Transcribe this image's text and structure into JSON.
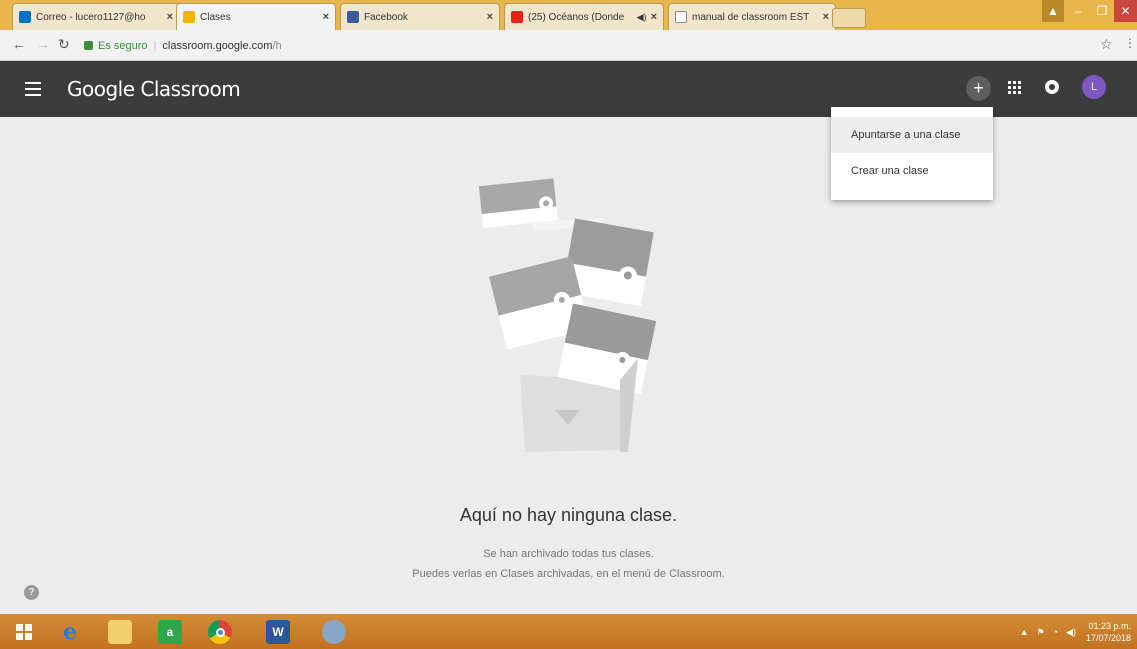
{
  "browser": {
    "tabs": [
      {
        "label": "Correo - lucero1127@ho",
        "active": false,
        "favicon": "outlook-icon"
      },
      {
        "label": "Clases",
        "active": true,
        "favicon": "classroom-icon"
      },
      {
        "label": "Facebook",
        "active": false,
        "favicon": "facebook-icon"
      },
      {
        "label": "(25) Océanos (Donde",
        "active": false,
        "favicon": "youtube-icon"
      },
      {
        "label": "manual de classroom EST",
        "active": false,
        "favicon": "document-icon"
      }
    ],
    "close_glyph": "×",
    "address": {
      "secure_label": "Es seguro",
      "url_host": "classroom.google.com",
      "url_path": "/h"
    }
  },
  "app": {
    "title": "Google Classroom",
    "plus_label": "+",
    "avatar_initial": "L",
    "avatar_color": "#7e57c2",
    "header_color": "#3c3c3c"
  },
  "menu": {
    "items": [
      {
        "label": "Apuntarse a una clase"
      },
      {
        "label": "Crear una clase"
      }
    ]
  },
  "empty_state": {
    "title": "Aquí no hay ninguna clase.",
    "line1": "Se han archivado todas tus clases.",
    "line2": "Puedes verlas en Clases archivadas, en el menú de Classroom."
  },
  "help": {
    "glyph": "?"
  },
  "taskbar": {
    "apps": [
      "windows-start-icon",
      "internet-explorer-icon",
      "file-explorer-icon",
      "store-icon",
      "chrome-icon",
      "word-icon",
      "paint-icon"
    ],
    "time": "01:23 p.m.",
    "date": "17/07/2018"
  }
}
